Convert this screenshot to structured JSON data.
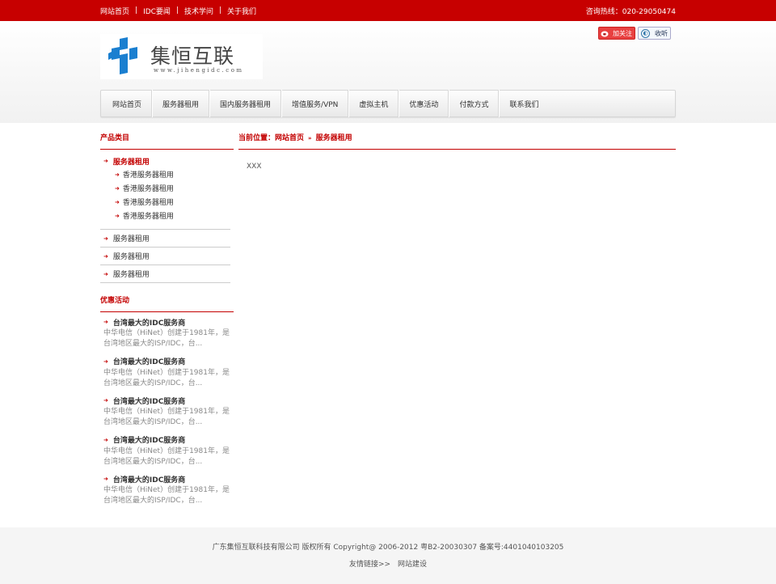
{
  "topbar": {
    "links": [
      "网站首页",
      "IDC要闻",
      "技术学问",
      "关于我们"
    ],
    "separator": "|",
    "hotline": "咨询热线：020-29050474"
  },
  "header": {
    "logo_text": "集恒互联",
    "logo_url": "www.jihengidc.com",
    "weibo_label": "加关注",
    "listen_label": "收听",
    "brand_color": "#c70000"
  },
  "nav": {
    "items": [
      "网站首页",
      "服务器租用",
      "国内服务器租用",
      "增值服务/VPN",
      "虚拟主机",
      "优惠活动",
      "付款方式",
      "联系我们"
    ]
  },
  "sidebar": {
    "title": "产品类目",
    "active_category": "服务器租用",
    "sub_items": [
      "香港服务器租用",
      "香港服务器租用",
      "香港服务器租用",
      "香港服务器租用"
    ],
    "categories": [
      "服务器租用",
      "服务器租用",
      "服务器租用"
    ],
    "promo_title": "优惠活动",
    "promos": [
      {
        "title": "台湾最大的IDC服务商",
        "desc": "中华电信（HiNet）创建于1981年，是台湾地区最大的ISP/IDC，台..."
      },
      {
        "title": "台湾最大的IDC服务商",
        "desc": "中华电信（HiNet）创建于1981年，是台湾地区最大的ISP/IDC，台..."
      },
      {
        "title": "台湾最大的IDC服务商",
        "desc": "中华电信（HiNet）创建于1981年，是台湾地区最大的ISP/IDC，台..."
      },
      {
        "title": "台湾最大的IDC服务商",
        "desc": "中华电信（HiNet）创建于1981年，是台湾地区最大的ISP/IDC，台..."
      },
      {
        "title": "台湾最大的IDC服务商",
        "desc": "中华电信（HiNet）创建于1981年，是台湾地区最大的ISP/IDC，台..."
      }
    ]
  },
  "content": {
    "crumb_prefix": "当前位置：",
    "crumb_home": "网站首页",
    "crumb_sep": "»",
    "crumb_current": "服务器租用",
    "body": "XXX"
  },
  "footer": {
    "copyright": "广东集恒互联科技有限公司 版权所有 Copyright@ 2006-2012 粤B2-20030307 备案号:4401040103205",
    "friends_label": "友情链接>>",
    "friends_link": "网站建设"
  }
}
